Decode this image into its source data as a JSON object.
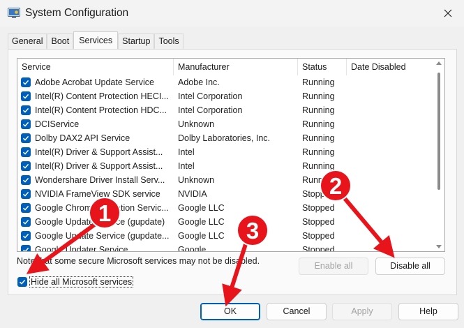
{
  "window": {
    "title": "System Configuration"
  },
  "tabs": [
    {
      "label": "General"
    },
    {
      "label": "Boot"
    },
    {
      "label": "Services"
    },
    {
      "label": "Startup"
    },
    {
      "label": "Tools"
    }
  ],
  "columns": {
    "service": "Service",
    "manufacturer": "Manufacturer",
    "status": "Status",
    "date_disabled": "Date Disabled"
  },
  "services": [
    {
      "name": "Adobe Acrobat Update Service",
      "manufacturer": "Adobe Inc.",
      "status": "Running",
      "checked": true
    },
    {
      "name": "Intel(R) Content Protection HECI...",
      "manufacturer": "Intel Corporation",
      "status": "Running",
      "checked": true
    },
    {
      "name": "Intel(R) Content Protection HDC...",
      "manufacturer": "Intel Corporation",
      "status": "Running",
      "checked": true
    },
    {
      "name": "DCIService",
      "manufacturer": "Unknown",
      "status": "Running",
      "checked": true
    },
    {
      "name": "Dolby DAX2 API Service",
      "manufacturer": "Dolby Laboratories, Inc.",
      "status": "Running",
      "checked": true
    },
    {
      "name": "Intel(R) Driver & Support Assist...",
      "manufacturer": "Intel",
      "status": "Running",
      "checked": true
    },
    {
      "name": "Intel(R) Driver & Support Assist...",
      "manufacturer": "Intel",
      "status": "Running",
      "checked": true
    },
    {
      "name": "Wondershare Driver Install Serv...",
      "manufacturer": "Unknown",
      "status": "Running",
      "checked": true
    },
    {
      "name": "NVIDIA FrameView SDK service",
      "manufacturer": "NVIDIA",
      "status": "Stopped",
      "checked": true
    },
    {
      "name": "Google Chrome Elevation Servic...",
      "manufacturer": "Google LLC",
      "status": "Stopped",
      "checked": true
    },
    {
      "name": "Google Update Service (gupdate)",
      "manufacturer": "Google LLC",
      "status": "Stopped",
      "checked": true
    },
    {
      "name": "Google Update Service (gupdate...",
      "manufacturer": "Google LLC",
      "status": "Stopped",
      "checked": true
    },
    {
      "name": "Google Updater Service",
      "manufacturer": "Google",
      "status": "Stopped",
      "checked": true
    }
  ],
  "note": "Note that some secure Microsoft services may not be disabled.",
  "buttons": {
    "enable_all": "Enable all",
    "disable_all": "Disable all",
    "ok": "OK",
    "cancel": "Cancel",
    "apply": "Apply",
    "help": "Help"
  },
  "hide_ms": {
    "label": "Hide all Microsoft services",
    "checked": true
  },
  "annotations": [
    {
      "number": "1",
      "color": "#e8141b"
    },
    {
      "number": "2",
      "color": "#e8141b"
    },
    {
      "number": "3",
      "color": "#e8141b"
    }
  ],
  "colors": {
    "accent": "#005fb8",
    "annotation": "#e8141b"
  },
  "icons": {
    "app": "system-configuration-icon",
    "close": "close-icon",
    "check": "checkmark-icon"
  }
}
